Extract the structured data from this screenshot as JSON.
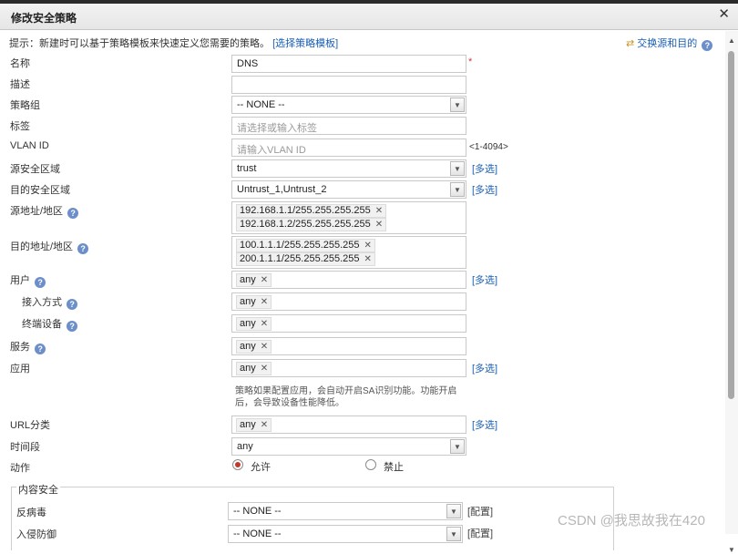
{
  "dialog": {
    "title": "修改安全策略",
    "close_icon": "✕"
  },
  "hint": {
    "text": "提示：新建时可以基于策略模板来快速定义您需要的策略。",
    "link": "[选择策略模板]"
  },
  "swap": {
    "label": "交换源和目的"
  },
  "help_glyph": "?",
  "required_mark": "*",
  "more_label": "[多选]",
  "config_label": "[配置]",
  "remove_glyph": "✕",
  "select_arrow": "▼",
  "form": {
    "name": {
      "label": "名称",
      "value": "DNS"
    },
    "description": {
      "label": "描述",
      "value": ""
    },
    "policy_group": {
      "label": "策略组",
      "value": "-- NONE --"
    },
    "tags": {
      "label": "标签",
      "placeholder": "请选择或输入标签"
    },
    "vlan": {
      "label": "VLAN ID",
      "placeholder": "请输入VLAN ID",
      "range": "<1-4094>"
    },
    "src_zone": {
      "label": "源安全区域",
      "value": "trust"
    },
    "dst_zone": {
      "label": "目的安全区域",
      "value": "Untrust_1,Untrust_2"
    },
    "src_addr": {
      "label": "源地址/地区",
      "items": [
        "192.168.1.1/255.255.255.255",
        "192.168.1.2/255.255.255.255"
      ]
    },
    "dst_addr": {
      "label": "目的地址/地区",
      "items": [
        "100.1.1.1/255.255.255.255",
        "200.1.1.1/255.255.255.255"
      ]
    },
    "user": {
      "label": "用户",
      "items": [
        "any"
      ]
    },
    "access_method": {
      "label": "接入方式",
      "items": [
        "any"
      ]
    },
    "terminal_device": {
      "label": "终端设备",
      "items": [
        "any"
      ]
    },
    "service": {
      "label": "服务",
      "items": [
        "any"
      ]
    },
    "application": {
      "label": "应用",
      "items": [
        "any"
      ],
      "note": "策略如果配置应用，会自动开启SA识别功能。功能开启后，会导致设备性能降低。"
    },
    "url_category": {
      "label": "URL分类",
      "items": [
        "any"
      ]
    },
    "time_range": {
      "label": "时间段",
      "value": "any"
    },
    "action": {
      "label": "动作",
      "permit": "允许",
      "deny": "禁止",
      "selected": "permit"
    }
  },
  "content_security": {
    "legend": "内容安全",
    "antivirus": {
      "label": "反病毒",
      "value": "-- NONE --"
    },
    "intrusion": {
      "label": "入侵防御",
      "value": "-- NONE --"
    }
  },
  "watermark": "CSDN @我思故我在420"
}
